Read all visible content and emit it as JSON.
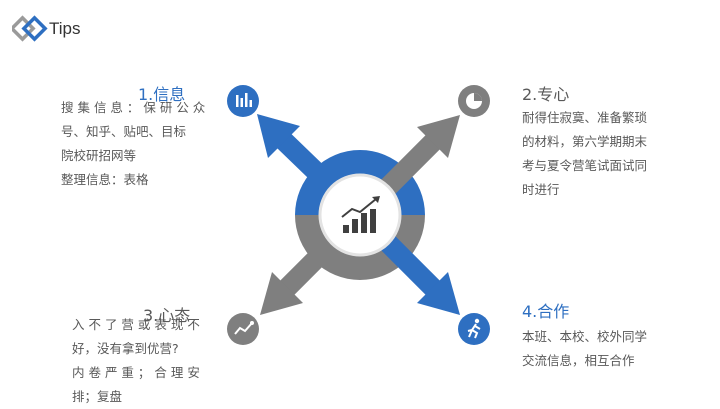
{
  "header": {
    "brand": "Tips"
  },
  "colors": {
    "blue": "#2e6fc1",
    "gray": "#7f7f7f",
    "dark": "#404040"
  },
  "center": {
    "icon": "trend-chart-icon"
  },
  "quadrants": [
    {
      "id": "info",
      "title": "1.信息",
      "icon": "bar-chart-icon",
      "color": "blue",
      "lines": [
        "搜 集 信 息 ： 保 研 公 众",
        "号、知乎、贴吧、目标",
        "院校研招网等",
        "整理信息：表格"
      ]
    },
    {
      "id": "focus",
      "title": "2.专心",
      "icon": "pie-chart-icon",
      "color": "gray",
      "lines": [
        "耐得住寂寞、准备繁琐",
        "的材料，第六学期期末",
        "考与夏令营笔试面试同",
        "时进行"
      ]
    },
    {
      "id": "mindset",
      "title": "3.心态",
      "icon": "line-chart-icon",
      "color": "gray",
      "lines": [
        "入 不 了 营 或 表 现 不",
        "好，没有拿到优营?",
        "内 卷 严 重 ； 合 理 安",
        "排；复盘"
      ]
    },
    {
      "id": "cooperation",
      "title": "4.合作",
      "icon": "running-person-icon",
      "color": "blue",
      "lines": [
        "本班、本校、校外同学",
        "交流信息，相互合作"
      ]
    }
  ]
}
